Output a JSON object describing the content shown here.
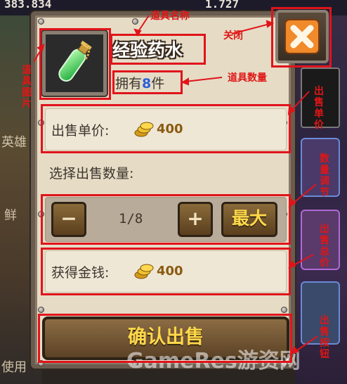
{
  "background": {
    "top_left_number": "383.834",
    "top_right_number": "1.727",
    "left_text_1": "英雄",
    "left_text_2": "鲜",
    "left_text_3": "使用"
  },
  "dialog": {
    "item_name": "经验药水",
    "owned_prefix": "拥有",
    "owned_count": "8",
    "owned_suffix": "件",
    "unit_price_label": "出售单价:",
    "unit_price_value": "400",
    "select_quantity_label": "选择出售数量:",
    "minus_label": "−",
    "quantity_display": "1/8",
    "plus_label": "+",
    "max_label": "最大",
    "earn_label": "获得金钱:",
    "earn_value": "400",
    "confirm_label": "确认出售"
  },
  "annotations": {
    "item_name": "道具名称",
    "close": "关闭",
    "item_image": "道具图片",
    "item_count": "道具数量",
    "unit_price": "出售单价",
    "quantity_adjust": "数量调节",
    "sale_total": "出售总价",
    "sell_button": "出售按钮"
  },
  "watermark": "GameRes游资网",
  "colors": {
    "annotation_red": "#e0141b",
    "panel_bg": "#e6dcc6",
    "gold_text": "#ffd84a",
    "count_blue": "#2a5ed8"
  },
  "icons": [
    "potion-icon",
    "gold-coin-icon",
    "close-x-icon"
  ]
}
